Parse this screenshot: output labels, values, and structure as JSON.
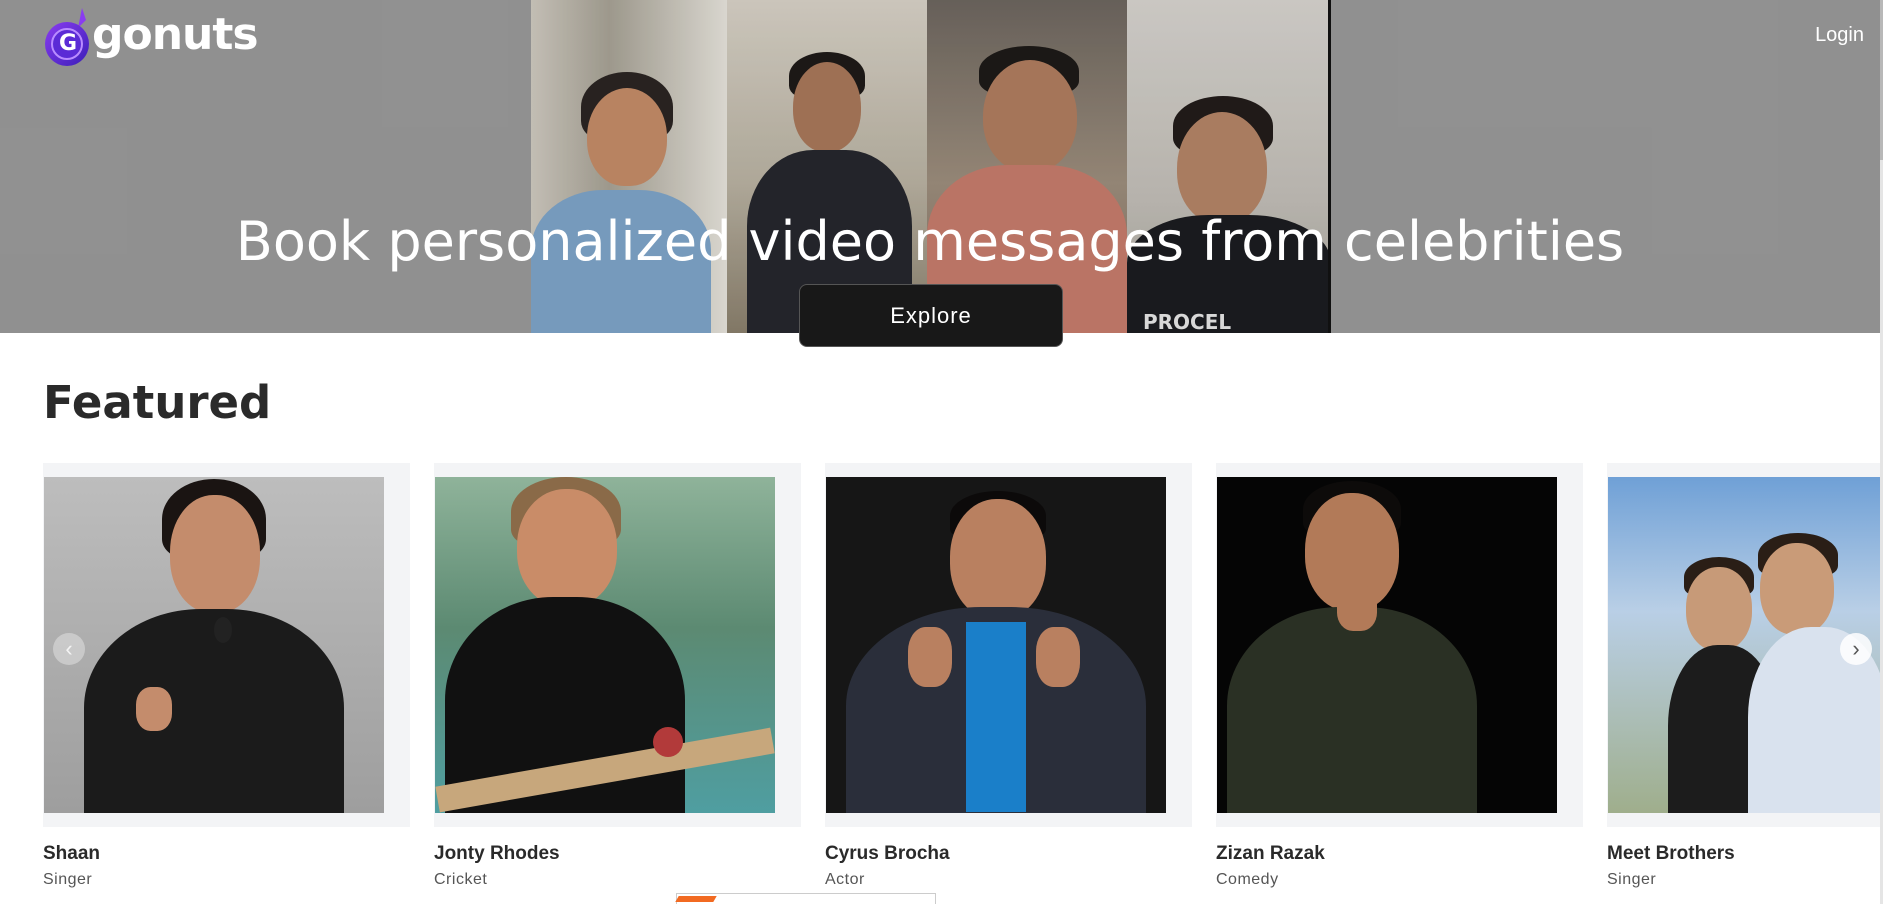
{
  "header": {
    "logo_text": "gonuts",
    "logo_mark_letter": "G",
    "login_label": "Login",
    "brand_colors": {
      "mark_outer": "#5b2bd6",
      "mark_inner": "#8a3cf0",
      "text": "#ffffff"
    }
  },
  "hero": {
    "title": "Book personalized video messages from celebrities",
    "explore_label": "Explore",
    "tiles": [
      {
        "shirt_text": ""
      },
      {
        "shirt_text": ""
      },
      {
        "shirt_text": ""
      },
      {
        "shirt_text": "PROCEL"
      }
    ]
  },
  "featured": {
    "title": "Featured",
    "prev_icon": "chevron-left-icon",
    "next_icon": "chevron-right-icon",
    "items": [
      {
        "name": "Shaan",
        "category": "Singer"
      },
      {
        "name": "Jonty Rhodes",
        "category": "Cricket"
      },
      {
        "name": "Cyrus Brocha",
        "category": "Actor"
      },
      {
        "name": "Zizan Razak",
        "category": "Comedy"
      },
      {
        "name": "Meet Brothers",
        "category": "Singer"
      }
    ]
  },
  "colors": {
    "hero_bg": "#9a9a9a",
    "button_bg": "#181818",
    "card_bg": "#f3f4f6",
    "footer_accent": "#f26a21"
  }
}
